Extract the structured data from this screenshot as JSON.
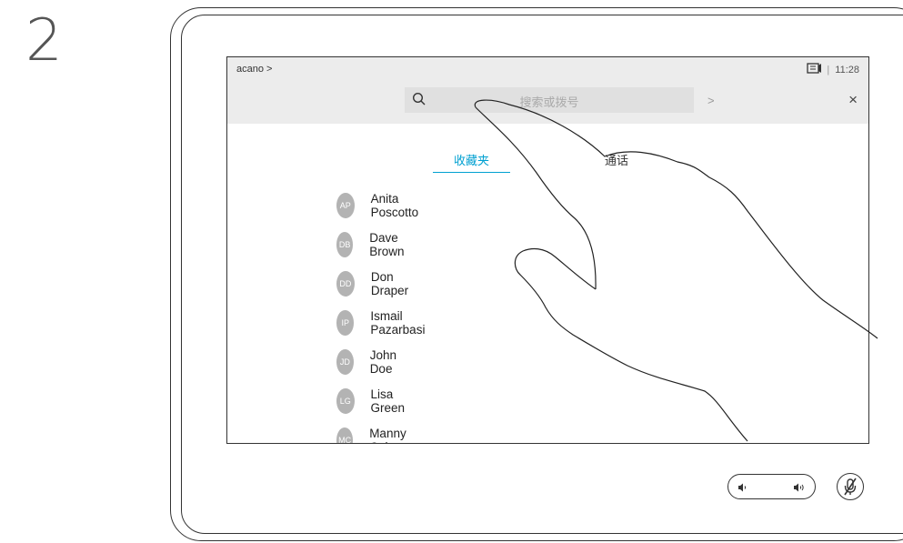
{
  "step_number": "2",
  "topbar": {
    "breadcrumb": "acano >",
    "time": "11:28",
    "time_separator": "|",
    "search_placeholder": "搜索或拨号",
    "forward_symbol": ">",
    "close_symbol": "×"
  },
  "tabs": [
    {
      "label": "收藏夹",
      "active": true
    },
    {
      "label": "通话",
      "active": false
    }
  ],
  "contacts": [
    {
      "initials": "AP",
      "name": "Anita Poscotto"
    },
    {
      "initials": "DB",
      "name": "Dave Brown"
    },
    {
      "initials": "DD",
      "name": "Don Draper"
    },
    {
      "initials": "IP",
      "name": "Ismail Pazarbasi"
    },
    {
      "initials": "JD",
      "name": "John Doe"
    },
    {
      "initials": "LG",
      "name": "Lisa Green"
    },
    {
      "initials": "MC",
      "name": "Manny Calavera"
    }
  ],
  "icons": {
    "search": "search-icon",
    "presentation": "presentation-icon",
    "volume_down": "volume-down-icon",
    "volume_up": "volume-up-icon",
    "mute": "microphone-mute-icon"
  },
  "colors": {
    "accent": "#00a0d1",
    "avatar": "#b3b3b3",
    "topbar_bg": "#ececec"
  }
}
